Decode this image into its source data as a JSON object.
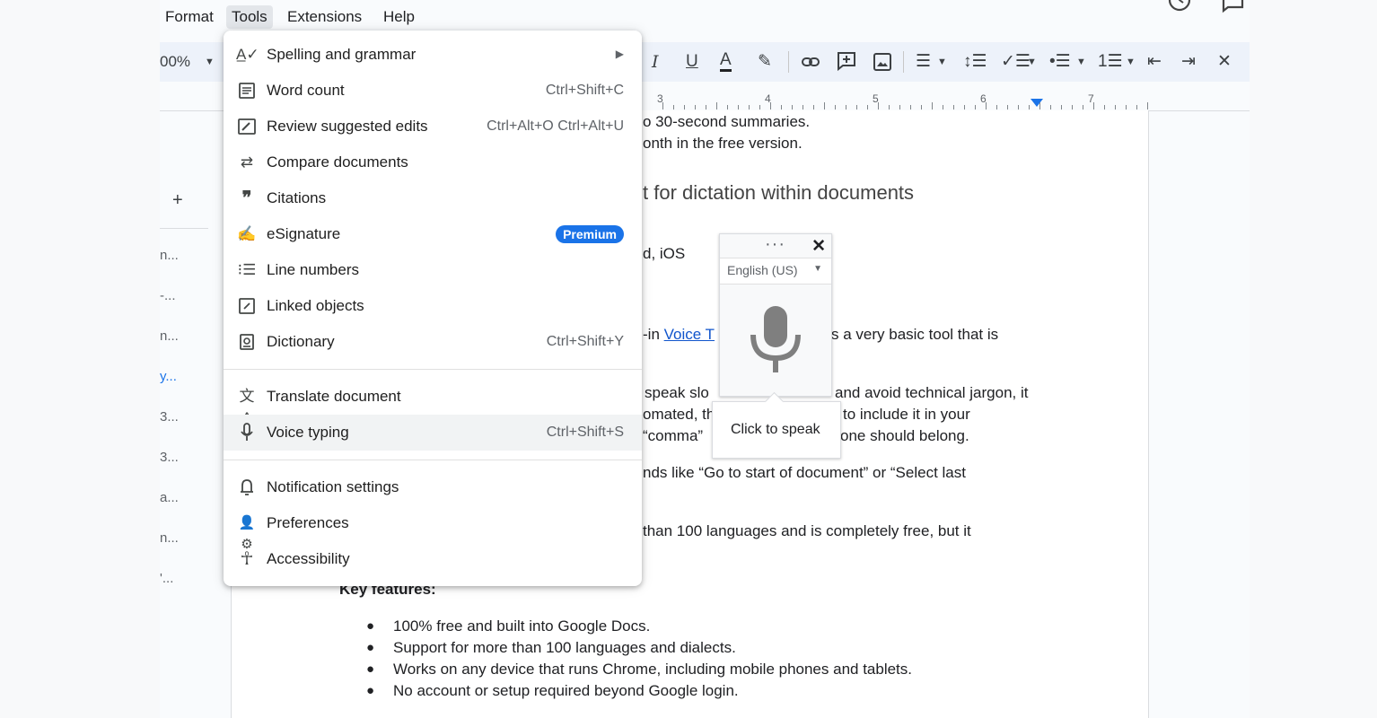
{
  "menubar": {
    "items": [
      "Format",
      "Tools",
      "Extensions",
      "Help"
    ]
  },
  "toolbar": {
    "zoom": "00%",
    "align_icon": "align-left-icon"
  },
  "ruler": {
    "numbers": [
      "3",
      "4",
      "5",
      "6",
      "7"
    ]
  },
  "outline": {
    "add": "+",
    "items": [
      "n...",
      "-...",
      "n...",
      "y...",
      "3...",
      "3...",
      "a...",
      "n...",
      "'..."
    ]
  },
  "document": {
    "line1": "o 30-second summaries.",
    "line2": "onth in the free version.",
    "heading": "t for dictation within documents",
    "line3": "d, iOS",
    "line4_pre": "-in ",
    "line4_link": "Voice T",
    "line4_post": "s a very basic tool that is",
    "line5": "speak slo",
    "line5b": "and avoid technical jargon, it",
    "line6": "omated, th",
    "line6b": "to include it in your",
    "line7": "“comma”",
    "line7b": "one should belong.",
    "line8": "nds like “Go to start of document” or “Select last",
    "line9": "than 100 languages and is completely free, but it",
    "key_features": "Key features:",
    "bullets": [
      "100% free and built into Google Docs.",
      "Support for more than 100 languages and dialects.",
      "Works on any device that runs Chrome, including mobile phones and tablets.",
      "No account or setup required beyond Google login."
    ]
  },
  "tools_menu": {
    "items": [
      {
        "label": "Spelling and grammar",
        "shortcut": "",
        "icon": "spellcheck-icon"
      },
      {
        "label": "Word count",
        "shortcut": "Ctrl+Shift+C",
        "icon": "word-count-icon"
      },
      {
        "label": "Review suggested edits",
        "shortcut": "Ctrl+Alt+O Ctrl+Alt+U",
        "icon": "review-edits-icon"
      },
      {
        "label": "Compare documents",
        "shortcut": "",
        "icon": "compare-icon"
      },
      {
        "label": "Citations",
        "shortcut": "",
        "icon": "quote-icon"
      },
      {
        "label": "eSignature",
        "badge": "Premium",
        "icon": "signature-icon"
      },
      {
        "label": "Line numbers",
        "shortcut": "",
        "icon": "line-numbers-icon"
      },
      {
        "label": "Linked objects",
        "shortcut": "",
        "icon": "link-icon"
      },
      {
        "label": "Dictionary",
        "shortcut": "Ctrl+Shift+Y",
        "icon": "dictionary-icon"
      },
      {
        "label": "Translate document",
        "shortcut": "",
        "icon": "translate-icon"
      },
      {
        "label": "Voice typing",
        "shortcut": "Ctrl+Shift+S",
        "icon": "mic-icon"
      },
      {
        "label": "Notification settings",
        "shortcut": "",
        "icon": "bell-icon"
      },
      {
        "label": "Preferences",
        "shortcut": "",
        "icon": "preferences-icon"
      },
      {
        "label": "Accessibility",
        "shortcut": "",
        "icon": "accessibility-icon"
      }
    ]
  },
  "voice_typing": {
    "language": "English (US)",
    "tooltip": "Click to speak"
  },
  "colors": {
    "accent": "#1a73e8",
    "link": "#1155cc",
    "toolbar_bg": "#edf2fa"
  }
}
